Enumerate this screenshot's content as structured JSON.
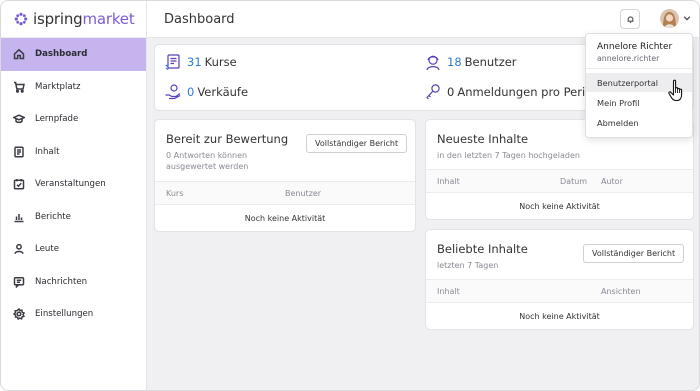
{
  "logo": {
    "part1": "ispring",
    "part2": "market"
  },
  "sidebar": {
    "items": [
      {
        "label": "Dashboard",
        "icon": "home-icon"
      },
      {
        "label": "Marktplatz",
        "icon": "cart-icon"
      },
      {
        "label": "Lernpfade",
        "icon": "graduation-cap-icon"
      },
      {
        "label": "Inhalt",
        "icon": "document-icon"
      },
      {
        "label": "Veranstaltungen",
        "icon": "calendar-icon"
      },
      {
        "label": "Berichte",
        "icon": "bar-chart-icon"
      },
      {
        "label": "Leute",
        "icon": "person-icon"
      },
      {
        "label": "Nachrichten",
        "icon": "message-icon"
      },
      {
        "label": "Einstellungen",
        "icon": "gear-icon"
      }
    ]
  },
  "header": {
    "title": "Dashboard"
  },
  "stats": {
    "courses": {
      "num": "31",
      "label": "Kurse"
    },
    "users": {
      "num": "18",
      "label": "Benutzer"
    },
    "sales": {
      "num": "0",
      "label": "Verkäufe"
    },
    "logins": {
      "num": "0",
      "label": "Anmeldungen pro Peric"
    }
  },
  "review": {
    "title": "Bereit zur Bewertung",
    "sub1": "0 Antworten können",
    "sub2": "ausgewertet werden",
    "button": "Vollständiger Bericht",
    "columns": [
      "Kurs",
      "Benutzer"
    ],
    "empty": "Noch keine Aktivität"
  },
  "newest": {
    "title": "Neueste Inhalte",
    "sub": "in den letzten 7 Tagen hochgeladen",
    "columns": [
      "Inhalt",
      "Datum",
      "Autor"
    ],
    "empty": "Noch keine Aktivität"
  },
  "popular": {
    "title": "Beliebte Inhalte",
    "sub": "letzten 7 Tagen",
    "button": "Vollständiger Bericht",
    "columns": [
      "Inhalt",
      "Ansichten"
    ],
    "empty": "Noch keine Aktivität"
  },
  "user_menu": {
    "name": "Annelore Richter",
    "username": "annelore.richter",
    "items": [
      "Benutzerportal",
      "Mein Profil",
      "Abmelden"
    ]
  },
  "colors": {
    "accent": "#7b5cd6",
    "active_nav": "#c6b4ee",
    "number_blue": "#2d7bd8"
  }
}
